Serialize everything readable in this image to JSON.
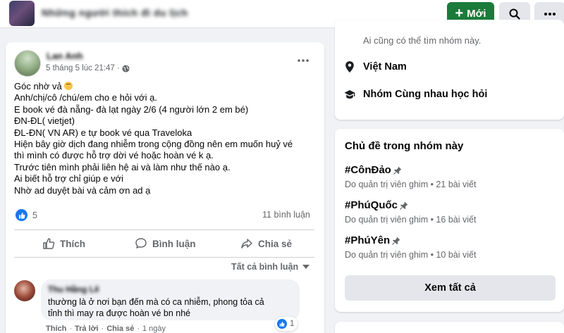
{
  "top_bar": {
    "group_name": "Những người thích đi du lịch",
    "new_button": "Mới",
    "new_button_icon": "plus-icon",
    "search_icon": "search-icon",
    "more_icon": "more-icon"
  },
  "post": {
    "author": "Lan Anh",
    "time": "5 tháng 5 lúc 21:47 ·",
    "audience_icon": "globe-icon",
    "body_lines": [
      "Góc nhờ vả",
      "Anh/chị/cô /chú/em cho e hỏi với ạ.",
      "E book vé đà nẵng- đà lạt ngày 2/6 (4 người lớn 2 em bé)",
      "ĐN-ĐL( vietjet)",
      "ĐL-ĐN( VN AR) e tự book vé qua Traveloka",
      "Hiện bây giờ dịch đang nhiễm trong cộng đồng nên em muốn huỷ vé",
      "thì mình có được hỗ trợ dời vé hoặc hoàn vé k ạ.",
      "Trước tiên mình phải liên hệ ai và làm như thế nào ạ.",
      "Ai biết hỗ trợ chỉ giúp e với",
      "Nhờ ad duyệt bài và cảm ơn ad ạ"
    ],
    "reaction_count": "5",
    "comment_count": "11 bình luận",
    "actions": {
      "like": "Thích",
      "comment": "Bình luận",
      "share": "Chia sẻ"
    },
    "sort_label": "Tất cả bình luận",
    "comment": {
      "author": "Thu Hằng Lê",
      "text_lines": [
        "thường là ở nơi bạn đến mà có ca nhiễm, phong tỏa cả",
        "tỉnh thì may ra được hoàn vé bn nhé"
      ],
      "like_count": "1",
      "like": "Thích",
      "reply": "Trả lời",
      "share": "Chia sẻ",
      "sep": "·",
      "age": "1 ngày"
    }
  },
  "about": {
    "visibility_sub": "Ai cũng có thể tìm nhóm này.",
    "location": "Việt Nam",
    "category": "Nhóm Cùng nhau học hỏi"
  },
  "topics": {
    "title": "Chủ đề trong nhóm này",
    "items": [
      {
        "tag": "#CônĐảo",
        "meta": "Do quản trị viên ghim • 21 bài viết"
      },
      {
        "tag": "#PhúQuốc",
        "meta": "Do quản trị viên ghim • 16 bài viết"
      },
      {
        "tag": "#PhúYên",
        "meta": "Do quản trị viên ghim • 10 bài viết"
      }
    ],
    "see_all": "Xem tất cả"
  },
  "colors": {
    "accent_green": "#1b7b3a",
    "like_blue": "#1877f2",
    "secondary_text": "#65676b",
    "page_bg": "#f0f2f5"
  }
}
